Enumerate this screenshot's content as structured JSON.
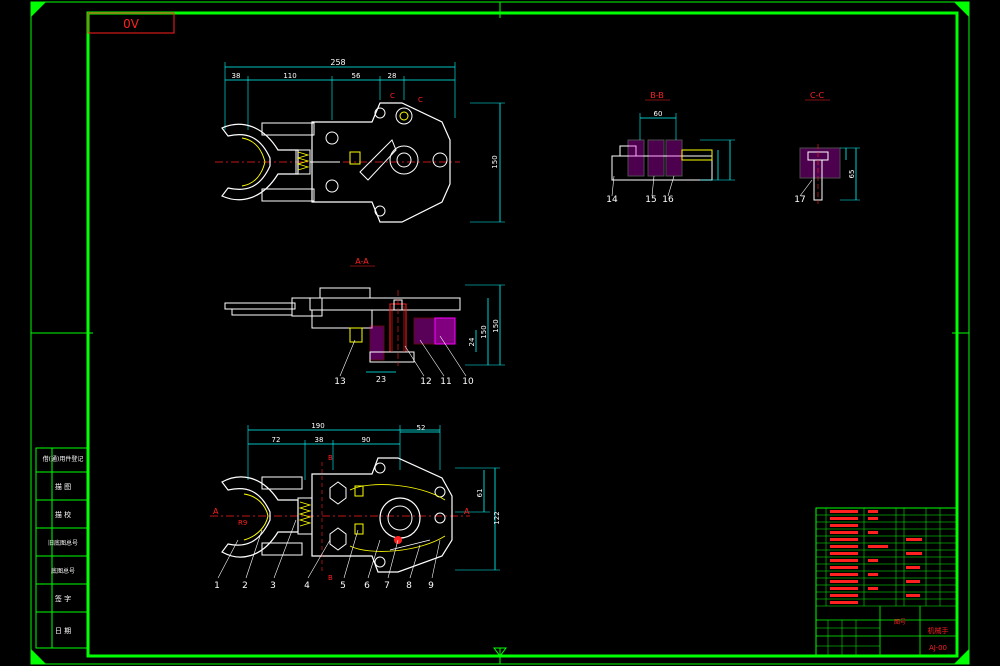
{
  "colors": {
    "frame": "#00ff00",
    "white": "#ffffff",
    "red": "#ff2020",
    "yellow": "#ffff00",
    "cyan": "#00ffff",
    "magenta": "#ff00ff",
    "background": "#000000"
  },
  "corner_tag": "0V",
  "section_labels": {
    "aa": "A-A",
    "bb": "B-B",
    "cc": "C-C"
  },
  "view_markers": {
    "c1": "C",
    "c2": "C",
    "a_left": "A",
    "a_right": "A",
    "b_top": "B",
    "b_bottom": "B"
  },
  "top_view_dims": {
    "overall": "258",
    "d1": "38",
    "d2": "110",
    "d3": "56",
    "d4": "28",
    "height": "150"
  },
  "section_aa_dims": {
    "bottom": "23",
    "v1": "150",
    "v2": "150",
    "v3": "24"
  },
  "bottom_view_dims": {
    "overall": "190",
    "d2": "72",
    "d3": "38",
    "d4": "90",
    "right": "52",
    "h1": "61",
    "h2": "122",
    "small": "R9"
  },
  "section_bb_dims": {
    "width": "60"
  },
  "section_cc_dims": {
    "h": "65"
  },
  "balloons_bottom": [
    "1",
    "2",
    "3",
    "4",
    "5",
    "6",
    "7",
    "8",
    "9"
  ],
  "balloons_aa": [
    "13",
    "23",
    "12",
    "11",
    "10"
  ],
  "balloons_bb": [
    "14",
    "15",
    "16"
  ],
  "balloons_cc": [
    "17"
  ],
  "left_block_labels": [
    "借(通)用件登记",
    "描 图",
    "描 校",
    "旧底图总号",
    "底图总号",
    "签 字",
    "日 期"
  ],
  "title_block": {
    "title_cell": "图号",
    "drawing_no": "AJ-00",
    "name_cell": "机械手"
  }
}
